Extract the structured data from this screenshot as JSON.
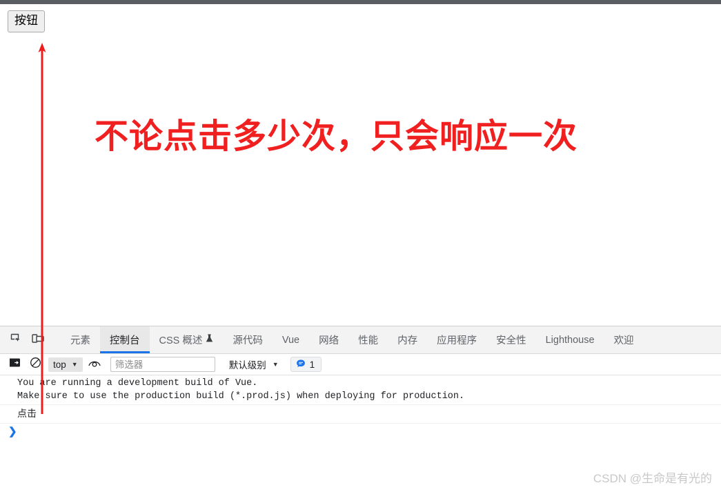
{
  "page": {
    "button_label": "按钮",
    "headline": "不论点击多少次，只会响应一次"
  },
  "annotation": {
    "arrow_color": "#ee1c1c",
    "arrow_name": "red-up-arrow"
  },
  "devtools": {
    "inspect_icon": "inspect-element-icon",
    "device_icon": "device-toolbar-icon",
    "tabs": [
      {
        "label": "元素",
        "active": false,
        "icon": null
      },
      {
        "label": "控制台",
        "active": true,
        "icon": null
      },
      {
        "label": "CSS 概述",
        "active": false,
        "icon": "experiment-flask-icon"
      },
      {
        "label": "源代码",
        "active": false,
        "icon": null
      },
      {
        "label": "Vue",
        "active": false,
        "icon": null
      },
      {
        "label": "网络",
        "active": false,
        "icon": null
      },
      {
        "label": "性能",
        "active": false,
        "icon": null
      },
      {
        "label": "内存",
        "active": false,
        "icon": null
      },
      {
        "label": "应用程序",
        "active": false,
        "icon": null
      },
      {
        "label": "安全性",
        "active": false,
        "icon": null
      },
      {
        "label": "Lighthouse",
        "active": false,
        "icon": null
      },
      {
        "label": "欢迎",
        "active": false,
        "icon": null
      }
    ],
    "toolbar": {
      "sidebar_icon": "console-sidebar-icon",
      "clear_icon": "clear-console-icon",
      "context_value": "top",
      "eye_icon": "live-expression-eye-icon",
      "filter_placeholder": "筛选器",
      "filter_value": "",
      "level_label": "默认级别",
      "message_count": "1",
      "message_icon": "speech-bubble-icon"
    },
    "console_rows": [
      "You are running a development build of Vue.",
      "Make sure to use the production build (*.prod.js) when deploying for production.",
      "点击"
    ],
    "prompt_symbol": "❯"
  },
  "watermark": "CSDN @生命是有光的",
  "colors": {
    "accent_blue": "#1a73e8",
    "annotation_red": "#ee1c1c",
    "headline_red": "#f02020",
    "top_strip": "#5a5e63"
  }
}
